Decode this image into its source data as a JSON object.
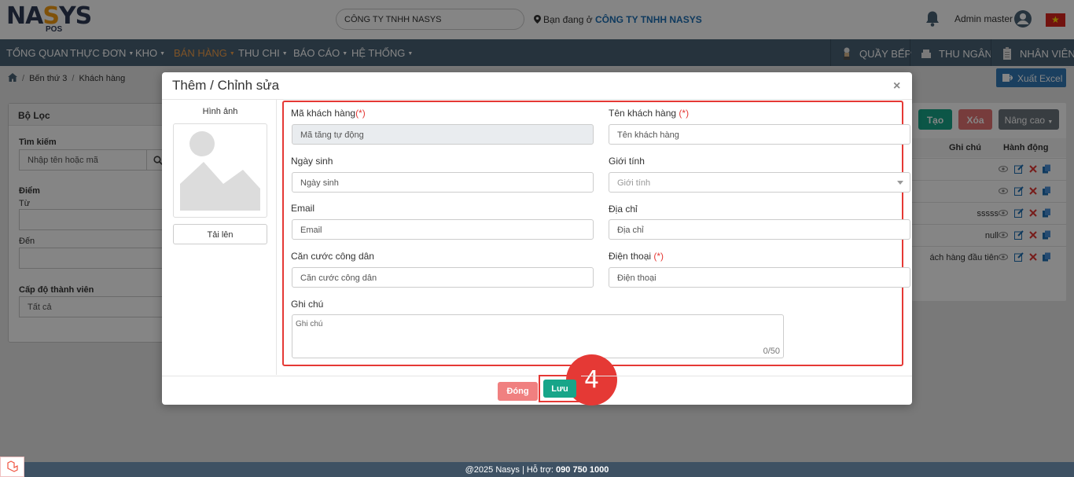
{
  "header": {
    "logo_main": "NASYS",
    "logo_sub": "POS",
    "company_select": "CÔNG TY TNHH NASYS",
    "location_prefix": "Bạn đang ở",
    "location_company": "CÔNG TY TNHH NASYS",
    "user_name": "Admin master"
  },
  "nav": {
    "items": [
      "TỔNG QUAN",
      "THỰC ĐƠN",
      "KHO",
      "BÁN HÀNG",
      "THU CHI",
      "BÁO CÁO",
      "HỆ THỐNG"
    ],
    "right": [
      "QUẦY BẾP",
      "THU NGÂN",
      "NHÂN VIÊN"
    ]
  },
  "breadcrumb": [
    "Bến thứ 3",
    "Khách hàng"
  ],
  "export_label": "Xuất Excel",
  "filter": {
    "title": "Bộ Lọc",
    "search_label": "Tìm kiếm",
    "search_placeholder": "Nhập tên hoặc mã",
    "points_label": "Điểm",
    "from_label": "Từ",
    "to_label": "Đến",
    "level_label": "Cấp độ thành viên",
    "level_value": "Tất cả"
  },
  "list": {
    "create_label": "Tạo",
    "delete_label": "Xóa",
    "advanced_label": "Nâng cao",
    "col_note": "Ghi chú",
    "col_actions": "Hành động",
    "rows": [
      "",
      "",
      "sssss",
      "null",
      "ách hàng đầu tiên"
    ]
  },
  "modal": {
    "title": "Thêm / Chỉnh sửa",
    "image_label": "Hình ảnh",
    "upload_label": "Tải lên",
    "code_label": "Mã khách hàng",
    "code_placeholder": "Mã tăng tự động",
    "name_label": "Tên khách hàng",
    "name_placeholder": "Tên khách hàng",
    "dob_label": "Ngày sinh",
    "dob_placeholder": "Ngày sinh",
    "gender_label": "Giới tính",
    "gender_placeholder": "Giới tính",
    "email_label": "Email",
    "email_placeholder": "Email",
    "address_label": "Địa chỉ",
    "address_placeholder": "Địa chỉ",
    "id_label": "Căn cước công dân",
    "id_placeholder": "Căn cước công dân",
    "phone_label": "Điện thoại",
    "phone_placeholder": "Điện thoại",
    "note_label": "Ghi chú",
    "note_placeholder": "Ghi chú",
    "note_counter": "0/50",
    "required_mark": "(*)",
    "close_label": "Đóng",
    "save_label": "Lưu",
    "step_number": "4"
  },
  "footer": {
    "text": "@2025 Nasys | Hỗ trợ:",
    "phone": "090 750 1000"
  },
  "colors": {
    "nav_bg": "#4a6276",
    "accent_orange": "#f0a04b",
    "highlight_red": "#e53935",
    "save_green": "#17a589",
    "close_pink": "#f08080",
    "link_blue": "#1e6fb5"
  }
}
